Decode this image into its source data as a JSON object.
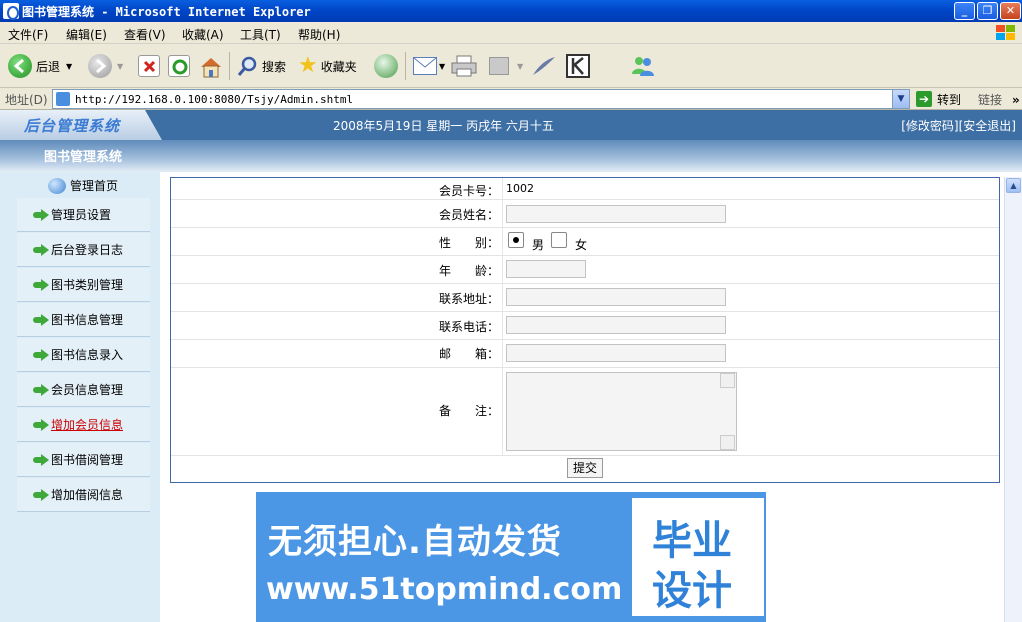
{
  "window": {
    "title": "图书管理系统 - Microsoft Internet Explorer",
    "buttons": [
      "_",
      "❐",
      "✕"
    ]
  },
  "menubar": {
    "items": [
      "文件(F)",
      "编辑(E)",
      "查看(V)",
      "收藏(A)",
      "工具(T)",
      "帮助(H)"
    ]
  },
  "toolbar": {
    "back_label": "后退",
    "search_label": "搜索",
    "favorites_label": "收藏夹"
  },
  "address": {
    "label": "地址(D)",
    "url": "http://192.168.0.100:8080/Tsjy/Admin.shtml",
    "go_label": "转到",
    "links_label": "链接",
    "more": "»"
  },
  "app": {
    "logo": "后台管理系统",
    "date": "2008年5月19日 星期一 丙戌年 六月十五",
    "change_password": "[修改密码]",
    "logout": "[安全退出]",
    "system_name": "图书管理系统"
  },
  "sidebar": {
    "home": "管理首页",
    "items": [
      {
        "label": "管理员设置"
      },
      {
        "label": "后台登录日志"
      },
      {
        "label": "图书类别管理"
      },
      {
        "label": "图书信息管理"
      },
      {
        "label": "图书信息录入"
      },
      {
        "label": "会员信息管理"
      },
      {
        "label": "增加会员信息",
        "active": true
      },
      {
        "label": "图书借阅管理"
      },
      {
        "label": "增加借阅信息"
      }
    ]
  },
  "form": {
    "card_label": "会员卡号：",
    "card_value": "1002",
    "name_label": "会员姓名：",
    "gender_label": "性　　别：",
    "gender_male": "男",
    "gender_female": "女",
    "gender_selected": "男",
    "age_label": "年　　龄：",
    "address_label": "联系地址：",
    "phone_label": "联系电话：",
    "email_label": "邮　　箱：",
    "remark_label": "备　　注：",
    "submit_label": "提交"
  },
  "banner": {
    "line1": "无须担心.自动发货",
    "line2": "www.51topmind.com",
    "seal_line1": "毕业",
    "seal_line2": "设计"
  },
  "colors": {
    "title_bar": "#0047c8",
    "app_header": "#3d6fa4",
    "sidebar_bg": "#dcecf6",
    "form_border": "#4068a8",
    "banner_bg": "#4b97e6",
    "active_link": "#cc0000"
  }
}
